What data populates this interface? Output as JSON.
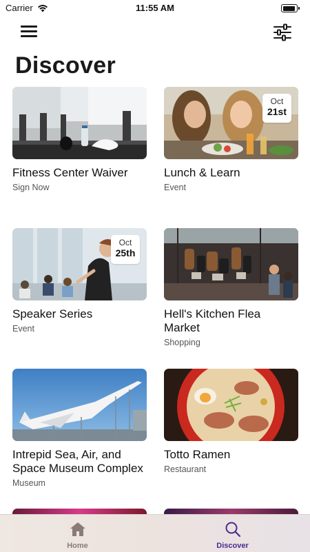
{
  "status_bar": {
    "carrier": "Carrier",
    "time": "11:55 AM"
  },
  "nav": {
    "menu_icon": "hamburger-menu-icon",
    "filter_icon": "sliders-filter-icon"
  },
  "page_title": "Discover",
  "cards": [
    {
      "title": "Fitness Center Waiver",
      "subtitle": "Sign Now"
    },
    {
      "title": "Lunch & Learn",
      "subtitle": "Event",
      "date_month": "Oct",
      "date_day": "21st"
    },
    {
      "title": "Speaker Series",
      "subtitle": "Event",
      "date_month": "Oct",
      "date_day": "25th"
    },
    {
      "title": "Hell's Kitchen Flea Market",
      "subtitle": "Shopping"
    },
    {
      "title": "Intrepid Sea, Air, and Space Museum Complex",
      "subtitle": "Museum"
    },
    {
      "title": "Totto Ramen",
      "subtitle": "Restaurant"
    }
  ],
  "tab_bar": {
    "tabs": [
      {
        "label": "Home",
        "icon": "home-icon",
        "color": "#8a7b74"
      },
      {
        "label": "Discover",
        "icon": "search-icon",
        "color": "#4b2a8f"
      }
    ]
  }
}
